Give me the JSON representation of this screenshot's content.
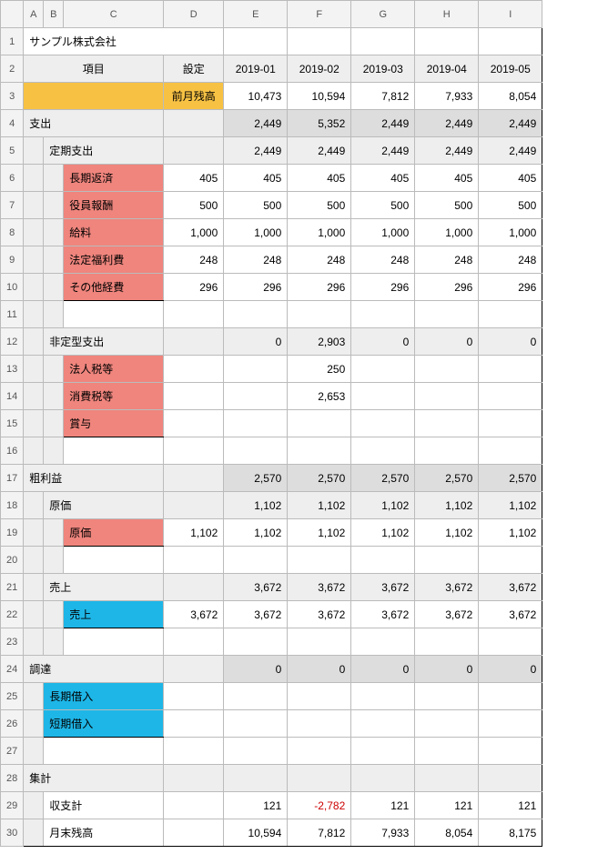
{
  "colHeaders": [
    "A",
    "B",
    "C",
    "D",
    "E",
    "F",
    "G",
    "H",
    "I"
  ],
  "rowHeaders": [
    "1",
    "2",
    "3",
    "4",
    "5",
    "6",
    "7",
    "8",
    "9",
    "10",
    "11",
    "12",
    "13",
    "14",
    "15",
    "16",
    "17",
    "18",
    "19",
    "20",
    "21",
    "22",
    "23",
    "24",
    "25",
    "26",
    "27",
    "28",
    "29",
    "30"
  ],
  "title": "サンプル株式会社",
  "hdr": {
    "item": "項目",
    "setting": "設定"
  },
  "months": [
    "2019-01",
    "2019-02",
    "2019-03",
    "2019-04",
    "2019-05"
  ],
  "r3": {
    "label": "前月残高",
    "v": [
      "10,473",
      "10,594",
      "7,812",
      "7,933",
      "8,054"
    ]
  },
  "r4": {
    "label": "支出",
    "v": [
      "2,449",
      "5,352",
      "2,449",
      "2,449",
      "2,449"
    ]
  },
  "r5": {
    "label": "定期支出",
    "v": [
      "2,449",
      "2,449",
      "2,449",
      "2,449",
      "2,449"
    ]
  },
  "r6": {
    "label": "長期返済",
    "d": "405",
    "v": [
      "405",
      "405",
      "405",
      "405",
      "405"
    ]
  },
  "r7": {
    "label": "役員報酬",
    "d": "500",
    "v": [
      "500",
      "500",
      "500",
      "500",
      "500"
    ]
  },
  "r8": {
    "label": "給料",
    "d": "1,000",
    "v": [
      "1,000",
      "1,000",
      "1,000",
      "1,000",
      "1,000"
    ]
  },
  "r9": {
    "label": "法定福利費",
    "d": "248",
    "v": [
      "248",
      "248",
      "248",
      "248",
      "248"
    ]
  },
  "r10": {
    "label": "その他経費",
    "d": "296",
    "v": [
      "296",
      "296",
      "296",
      "296",
      "296"
    ]
  },
  "r12": {
    "label": "非定型支出",
    "v": [
      "0",
      "2,903",
      "0",
      "0",
      "0"
    ]
  },
  "r13": {
    "label": "法人税等",
    "v": [
      "",
      "250",
      "",
      "",
      ""
    ]
  },
  "r14": {
    "label": "消費税等",
    "v": [
      "",
      "2,653",
      "",
      "",
      ""
    ]
  },
  "r15": {
    "label": "賞与"
  },
  "r17": {
    "label": "粗利益",
    "v": [
      "2,570",
      "2,570",
      "2,570",
      "2,570",
      "2,570"
    ]
  },
  "r18": {
    "label": "原価",
    "v": [
      "1,102",
      "1,102",
      "1,102",
      "1,102",
      "1,102"
    ]
  },
  "r19": {
    "label": "原価",
    "d": "1,102",
    "v": [
      "1,102",
      "1,102",
      "1,102",
      "1,102",
      "1,102"
    ]
  },
  "r21": {
    "label": "売上",
    "v": [
      "3,672",
      "3,672",
      "3,672",
      "3,672",
      "3,672"
    ]
  },
  "r22": {
    "label": "売上",
    "d": "3,672",
    "v": [
      "3,672",
      "3,672",
      "3,672",
      "3,672",
      "3,672"
    ]
  },
  "r24": {
    "label": "調達",
    "v": [
      "0",
      "0",
      "0",
      "0",
      "0"
    ]
  },
  "r25": {
    "label": "長期借入"
  },
  "r26": {
    "label": "短期借入"
  },
  "r28": {
    "label": "集計"
  },
  "r29": {
    "label": "収支計",
    "v": [
      "121",
      "-2,782",
      "121",
      "121",
      "121"
    ]
  },
  "r30": {
    "label": "月末残高",
    "v": [
      "10,594",
      "7,812",
      "7,933",
      "8,054",
      "8,175"
    ]
  }
}
